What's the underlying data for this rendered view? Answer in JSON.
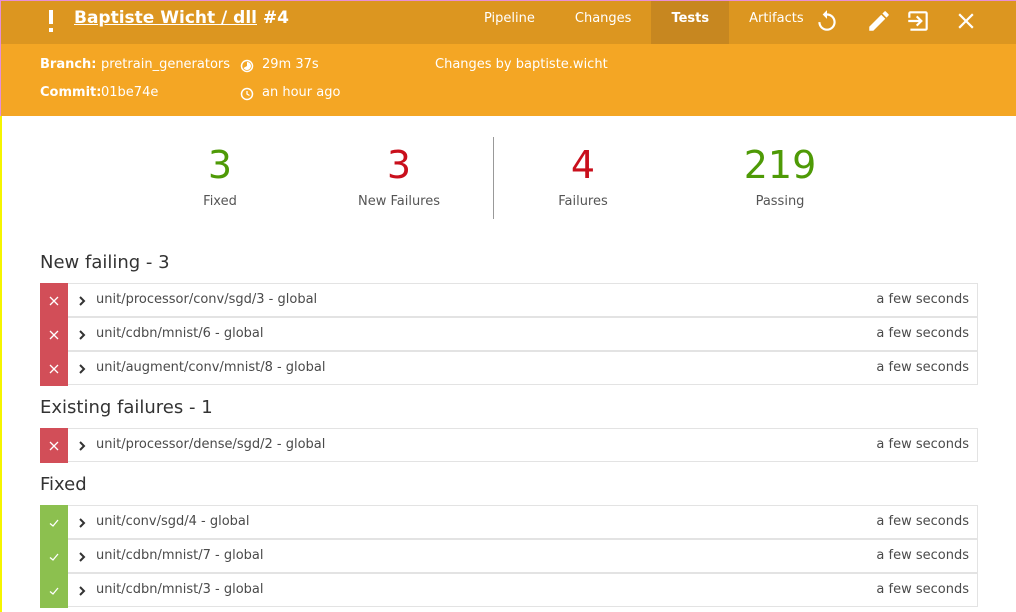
{
  "header": {
    "status": "unstable",
    "title_link": "Baptiste Wicht / dll",
    "run_number": "#4",
    "tabs": [
      {
        "label": "Pipeline",
        "active": false
      },
      {
        "label": "Changes",
        "active": false
      },
      {
        "label": "Tests",
        "active": true
      },
      {
        "label": "Artifacts",
        "active": false
      }
    ],
    "tools": [
      "replay-icon",
      "edit-icon",
      "exit-icon",
      "close-icon"
    ]
  },
  "meta": {
    "branch_label": "Branch:",
    "branch": "pretrain_generators",
    "commit_label": "Commit:",
    "commit": "01be74e",
    "duration": "29m 37s",
    "started": "an hour ago",
    "changes": "Changes by baptiste.wicht"
  },
  "summary": {
    "fixed": {
      "value": "3",
      "label": "Fixed"
    },
    "new_failures": {
      "value": "3",
      "label": "New Failures"
    },
    "failures": {
      "value": "4",
      "label": "Failures"
    },
    "passing": {
      "value": "219",
      "label": "Passing"
    }
  },
  "colors": {
    "topbar": "#dc9620",
    "meta": "#f4a624",
    "fail": "#d24e58",
    "pass": "#8cc04f",
    "green_text": "#4e9a06",
    "red_text": "#c90f1c"
  },
  "sections": [
    {
      "title": "New failing - 3",
      "status": "fail",
      "rows": [
        {
          "name": "unit/processor/conv/sgd/3 - global",
          "duration": "a few seconds"
        },
        {
          "name": "unit/cdbn/mnist/6 - global",
          "duration": "a few seconds"
        },
        {
          "name": "unit/augment/conv/mnist/8 - global",
          "duration": "a few seconds"
        }
      ]
    },
    {
      "title": "Existing failures - 1",
      "status": "fail",
      "rows": [
        {
          "name": "unit/processor/dense/sgd/2 - global",
          "duration": "a few seconds"
        }
      ]
    },
    {
      "title": "Fixed",
      "status": "ok",
      "rows": [
        {
          "name": "unit/conv/sgd/4 - global",
          "duration": "a few seconds"
        },
        {
          "name": "unit/cdbn/mnist/7 - global",
          "duration": "a few seconds"
        },
        {
          "name": "unit/cdbn/mnist/3 - global",
          "duration": "a few seconds"
        }
      ]
    }
  ]
}
